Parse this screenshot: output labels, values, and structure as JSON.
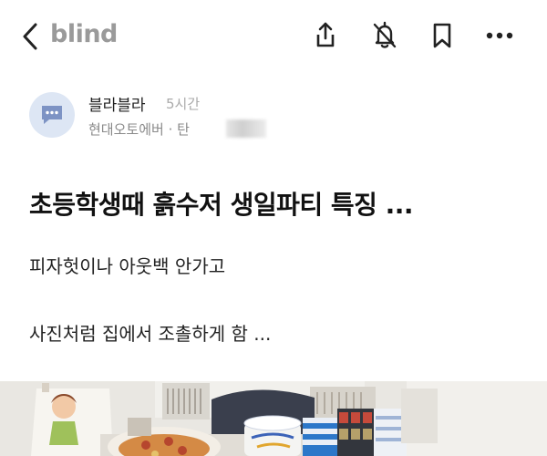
{
  "header": {
    "brand": "blind",
    "icons": [
      "back-chevron-icon",
      "share-icon",
      "notification-off-icon",
      "bookmark-icon",
      "more-icon"
    ]
  },
  "author": {
    "name": "블라블라",
    "time": "5시간",
    "company": "현대오토에버 · 탄"
  },
  "post": {
    "title": "초등학생때 흙수저 생일파티 특징 ...",
    "lines": [
      "피자헛이나 아웃백 안가고",
      "사진처럼 집에서 조촐하게 함 ..."
    ]
  },
  "colors": {
    "brand_gray": "#9a9a9a",
    "avatar_bg": "#dde6f4",
    "avatar_dots": "#7d93c4"
  }
}
